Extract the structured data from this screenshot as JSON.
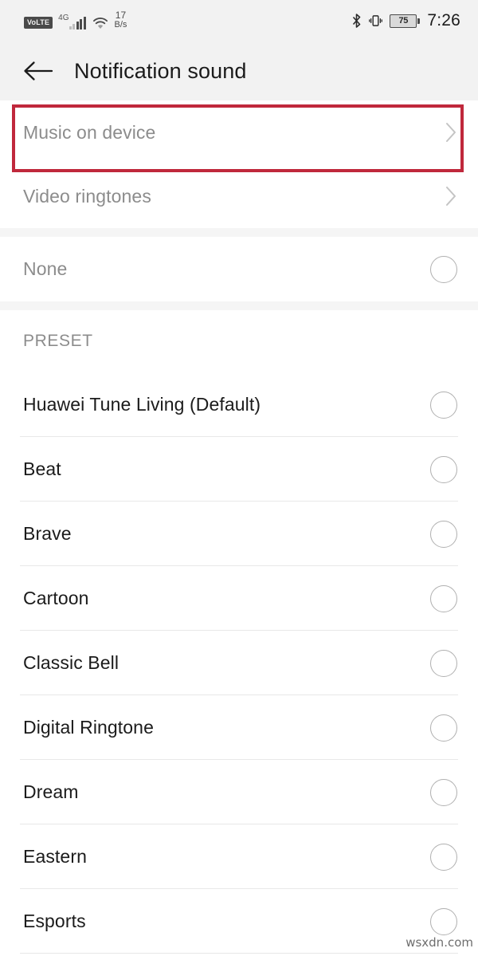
{
  "statusbar": {
    "volte_label": "VoLTE",
    "network_type": "4G",
    "netspeed_value": "17",
    "netspeed_unit": "B/s",
    "battery_level": "75",
    "clock": "7:26",
    "icons": [
      "volte-icon",
      "signal-bars-icon",
      "wifi-icon",
      "bluetooth-icon",
      "vibrate-icon",
      "battery-icon"
    ]
  },
  "appbar": {
    "title": "Notification sound",
    "back_icon": "back-arrow-icon"
  },
  "nav_section": {
    "items": [
      {
        "label": "Music on device",
        "chevron": "chevron-right-icon",
        "highlighted": true
      },
      {
        "label": "Video ringtones",
        "chevron": "chevron-right-icon",
        "highlighted": false
      }
    ]
  },
  "none_section": {
    "items": [
      {
        "label": "None",
        "selected": false
      }
    ]
  },
  "preset_section": {
    "header": "PRESET",
    "items": [
      {
        "label": "Huawei Tune Living (Default)",
        "selected": false
      },
      {
        "label": "Beat",
        "selected": false
      },
      {
        "label": "Brave",
        "selected": false
      },
      {
        "label": "Cartoon",
        "selected": false
      },
      {
        "label": "Classic Bell",
        "selected": false
      },
      {
        "label": "Digital Ringtone",
        "selected": false
      },
      {
        "label": "Dream",
        "selected": false
      },
      {
        "label": "Eastern",
        "selected": false
      },
      {
        "label": "Esports",
        "selected": false
      }
    ]
  },
  "annotation": {
    "color": "#c0283c",
    "target": "Music on device"
  },
  "watermark": {
    "text": "wsxdn.com"
  }
}
